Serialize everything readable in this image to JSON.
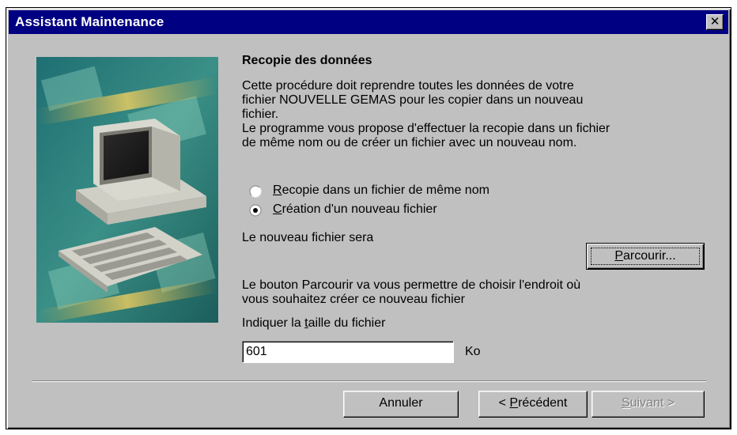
{
  "window": {
    "title": "Assistant Maintenance",
    "close_glyph": "✕"
  },
  "heading": "Recopie des données",
  "description": {
    "line1": "Cette procédure doit reprendre toutes les données de votre",
    "line2": "fichier NOUVELLE GEMAS  pour les copier dans un nouveau",
    "line3": "fichier.",
    "line4": "Le programme vous propose d'effectuer la recopie dans un fichier",
    "line5": "de même nom ou de créer un fichier avec un nouveau nom."
  },
  "options": [
    {
      "mnemonic": "R",
      "rest": "ecopie dans un fichier de même nom",
      "selected": false
    },
    {
      "mnemonic": "C",
      "rest": "réation d'un nouveau fichier",
      "selected": true
    }
  ],
  "new_file_label": "Le nouveau fichier sera",
  "browse_button": {
    "mnemonic": "P",
    "rest": "arcourir..."
  },
  "browse_hint": {
    "line1": "Le bouton Parcourir va vous permettre de choisir l'endroit où",
    "line2": "vous souhaitez créer ce nouveau fichier"
  },
  "size_label": {
    "before": "Indiquer la ",
    "mnemonic": "t",
    "after": "aille du fichier"
  },
  "size_input": {
    "value": "601",
    "unit": "Ko"
  },
  "buttons": {
    "cancel": "Annuler",
    "previous": {
      "before": "< ",
      "mnemonic": "P",
      "after": "récédent"
    },
    "next": {
      "mnemonic": "S",
      "after": "uivant >",
      "enabled": false
    }
  },
  "illustration": {
    "icon": "computer-keyboard-illustration",
    "colors": {
      "primary": "#2a7a7a",
      "accent": "#e6b340"
    }
  }
}
